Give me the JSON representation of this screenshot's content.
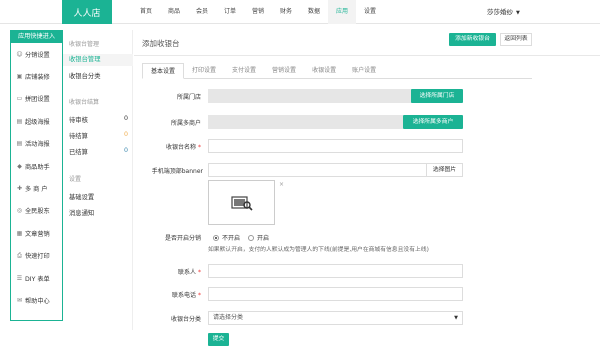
{
  "header": {
    "logo": "人人店",
    "nav": [
      "首页",
      "商品",
      "会员",
      "订单",
      "营销",
      "财务",
      "数据",
      "应用",
      "设置"
    ],
    "active_nav": "应用",
    "user": "莎莎婚纱",
    "user_caret": "▼"
  },
  "sidebar": {
    "title": "应用快捷进入",
    "items": [
      {
        "label": "分销设置",
        "icon": "users-icon"
      },
      {
        "label": "店铺装修",
        "icon": "shop-icon"
      },
      {
        "label": "拼团设置",
        "icon": "card-icon"
      },
      {
        "label": "超级海报",
        "icon": "poster-icon"
      },
      {
        "label": "活动海报",
        "icon": "poster-icon"
      },
      {
        "label": "商品助手",
        "icon": "helper-icon"
      },
      {
        "label": "多 商 户",
        "icon": "merchant-icon"
      },
      {
        "label": "全民股东",
        "icon": "share-icon"
      },
      {
        "label": "文章营销",
        "icon": "article-icon"
      },
      {
        "label": "快速打印",
        "icon": "print-icon"
      },
      {
        "label": "DIY 表单",
        "icon": "form-icon"
      },
      {
        "label": "帮助中心",
        "icon": "help-icon"
      }
    ]
  },
  "submenu": {
    "group1": "收银台管理",
    "item_manage": "收银台管理",
    "item_category": "收银台分类",
    "group2": "收银台结算",
    "status": [
      {
        "label": "待审核",
        "count": "0"
      },
      {
        "label": "待结算",
        "count": "0"
      },
      {
        "label": "已结算",
        "count": "0"
      }
    ],
    "group3": "设置",
    "item_basic": "基础设置",
    "item_notice": "消息通知"
  },
  "main": {
    "title": "添加收银台",
    "add_button": "添加新收银台",
    "back_button": "返回列表",
    "tabs": [
      "基本设置",
      "打印设置",
      "支付设置",
      "营销设置",
      "收银设置",
      "账户设置"
    ],
    "form": {
      "store_label": "所属门店",
      "store_button": "选择所属门店",
      "merchant_label": "所属多商户",
      "merchant_button": "选择所属多商户",
      "name_label": "收银台名称",
      "banner_label": "手机端顶部banner",
      "banner_button": "选择图片",
      "banner_close": "×",
      "distribution_label": "是否开启分销",
      "radio_off": "不开启",
      "radio_on": "开启",
      "distribution_help": "如果默认开启，支付的人默认成为管理人的下线(前提是,用户在商城有信息且没有上线)",
      "contact_label": "联系人",
      "phone_label": "联系电话",
      "category_label": "收银台分类",
      "category_placeholder": "请选择分类",
      "select_arrow": "▼",
      "required_mark": "*",
      "submit": "提交"
    }
  },
  "colors": {
    "accent": "#1bb394",
    "required": "#ee3333"
  }
}
